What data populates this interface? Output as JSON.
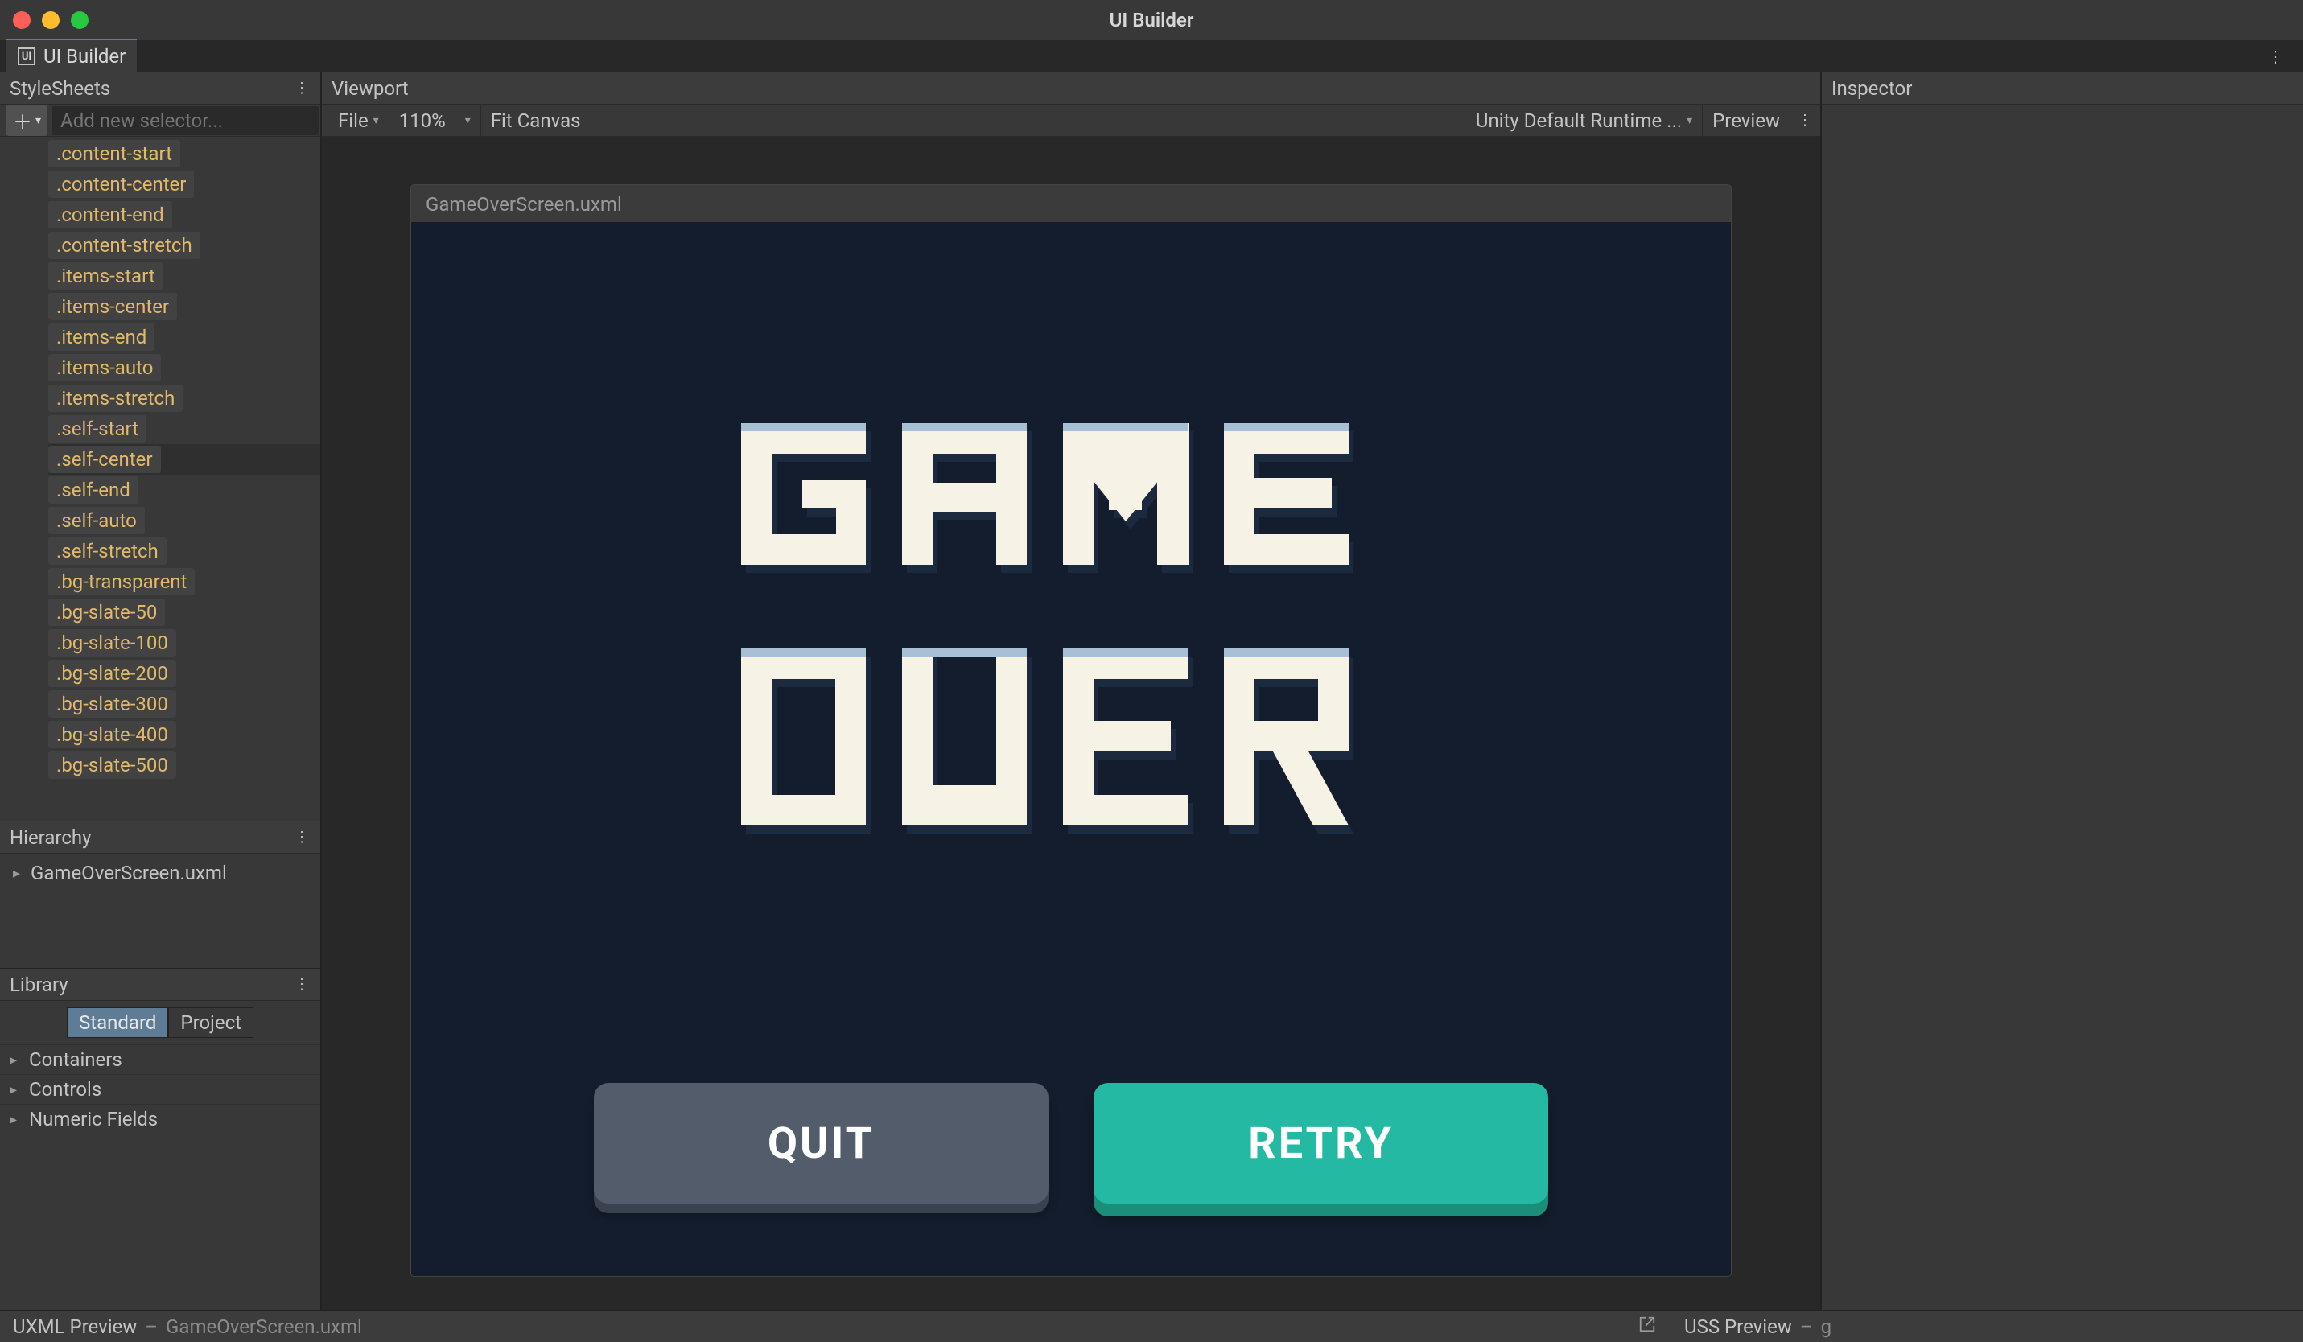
{
  "window": {
    "title": "UI Builder"
  },
  "tab": {
    "label": "UI Builder"
  },
  "panels": {
    "stylesheets_title": "StyleSheets",
    "hierarchy_title": "Hierarchy",
    "library_title": "Library",
    "viewport_title": "Viewport",
    "inspector_title": "Inspector"
  },
  "selector_input_placeholder": "Add new selector...",
  "stylesheet_classes": [
    ".content-start",
    ".content-center",
    ".content-end",
    ".content-stretch",
    ".items-start",
    ".items-center",
    ".items-end",
    ".items-auto",
    ".items-stretch",
    ".self-start",
    ".self-center",
    ".self-end",
    ".self-auto",
    ".self-stretch",
    ".bg-transparent",
    ".bg-slate-50",
    ".bg-slate-100",
    ".bg-slate-200",
    ".bg-slate-300",
    ".bg-slate-400",
    ".bg-slate-500"
  ],
  "stylesheet_selected_index": 10,
  "hierarchy": {
    "root": "GameOverScreen.uxml"
  },
  "library": {
    "tabs": [
      "Standard",
      "Project"
    ],
    "active_tab_index": 0,
    "categories": [
      "Containers",
      "Controls",
      "Numeric Fields"
    ]
  },
  "viewport": {
    "file_menu": "File",
    "zoom": "110%",
    "fit_canvas": "Fit Canvas",
    "theme": "Unity Default Runtime ...",
    "preview": "Preview",
    "canvas_filename": "GameOverScreen.uxml"
  },
  "gameover": {
    "line1": "GAME",
    "line2": "OVER",
    "quit_label": "QUIT",
    "retry_label": "RETRY"
  },
  "footer": {
    "uxml_preview": "UXML Preview",
    "uxml_file": "GameOverScreen.uxml",
    "uss_preview": "USS Preview",
    "uss_partial": "g"
  }
}
